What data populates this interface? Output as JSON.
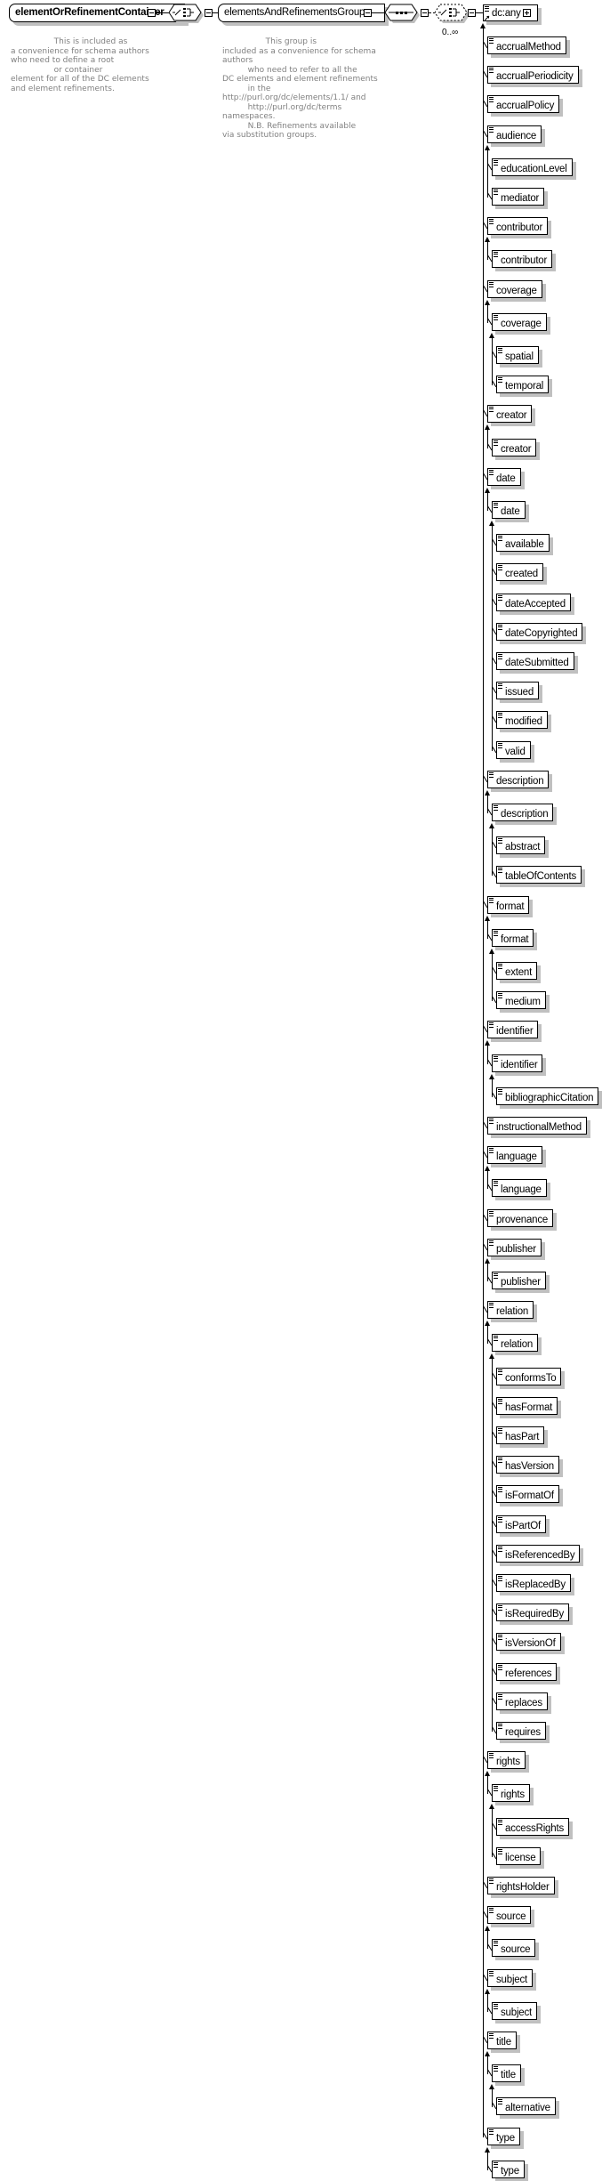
{
  "diagram": {
    "root": {
      "name": "elementOrRefinementContainer",
      "annotation": "                 This is included as\na convenience for schema authors\nwho need to define a root\n                 or container\nelement for all of the DC elements\nand element refinements."
    },
    "group": {
      "name": "elementsAndRefinementsGroup",
      "annotation": "                 This group is\nincluded as a convenience for schema\nauthors\n          who need to refer to all the\nDC elements and element refinements\n          in the\nhttp://purl.org/dc/elements/1.1/ and\n          http://purl.org/dc/terms\nnamespaces.\n          N.B. Refinements available\nvia substitution groups."
    },
    "choice_occurrence": "0..∞",
    "any_element": "dc:any",
    "elements": [
      {
        "label": "accrualMethod",
        "level": 1
      },
      {
        "label": "accrualPeriodicity",
        "level": 1
      },
      {
        "label": "accrualPolicy",
        "level": 1
      },
      {
        "label": "audience",
        "level": 1
      },
      {
        "label": "educationLevel",
        "level": 2
      },
      {
        "label": "mediator",
        "level": 2
      },
      {
        "label": "contributor",
        "level": 1
      },
      {
        "label": "contributor",
        "level": 2
      },
      {
        "label": "coverage",
        "level": 1
      },
      {
        "label": "coverage",
        "level": 2
      },
      {
        "label": "spatial",
        "level": 3
      },
      {
        "label": "temporal",
        "level": 3
      },
      {
        "label": "creator",
        "level": 1
      },
      {
        "label": "creator",
        "level": 2
      },
      {
        "label": "date",
        "level": 1
      },
      {
        "label": "date",
        "level": 2
      },
      {
        "label": "available",
        "level": 3
      },
      {
        "label": "created",
        "level": 3
      },
      {
        "label": "dateAccepted",
        "level": 3
      },
      {
        "label": "dateCopyrighted",
        "level": 3
      },
      {
        "label": "dateSubmitted",
        "level": 3
      },
      {
        "label": "issued",
        "level": 3
      },
      {
        "label": "modified",
        "level": 3
      },
      {
        "label": "valid",
        "level": 3
      },
      {
        "label": "description",
        "level": 1
      },
      {
        "label": "description",
        "level": 2
      },
      {
        "label": "abstract",
        "level": 3
      },
      {
        "label": "tableOfContents",
        "level": 3
      },
      {
        "label": "format",
        "level": 1
      },
      {
        "label": "format",
        "level": 2
      },
      {
        "label": "extent",
        "level": 3
      },
      {
        "label": "medium",
        "level": 3
      },
      {
        "label": "identifier",
        "level": 1
      },
      {
        "label": "identifier",
        "level": 2
      },
      {
        "label": "bibliographicCitation",
        "level": 3
      },
      {
        "label": "instructionalMethod",
        "level": 1
      },
      {
        "label": "language",
        "level": 1
      },
      {
        "label": "language",
        "level": 2
      },
      {
        "label": "provenance",
        "level": 1
      },
      {
        "label": "publisher",
        "level": 1
      },
      {
        "label": "publisher",
        "level": 2
      },
      {
        "label": "relation",
        "level": 1
      },
      {
        "label": "relation",
        "level": 2
      },
      {
        "label": "conformsTo",
        "level": 3
      },
      {
        "label": "hasFormat",
        "level": 3
      },
      {
        "label": "hasPart",
        "level": 3
      },
      {
        "label": "hasVersion",
        "level": 3
      },
      {
        "label": "isFormatOf",
        "level": 3
      },
      {
        "label": "isPartOf",
        "level": 3
      },
      {
        "label": "isReferencedBy",
        "level": 3
      },
      {
        "label": "isReplacedBy",
        "level": 3
      },
      {
        "label": "isRequiredBy",
        "level": 3
      },
      {
        "label": "isVersionOf",
        "level": 3
      },
      {
        "label": "references",
        "level": 3
      },
      {
        "label": "replaces",
        "level": 3
      },
      {
        "label": "requires",
        "level": 3
      },
      {
        "label": "rights",
        "level": 1
      },
      {
        "label": "rights",
        "level": 2
      },
      {
        "label": "accessRights",
        "level": 3
      },
      {
        "label": "license",
        "level": 3
      },
      {
        "label": "rightsHolder",
        "level": 1
      },
      {
        "label": "source",
        "level": 1
      },
      {
        "label": "source",
        "level": 2
      },
      {
        "label": "subject",
        "level": 1
      },
      {
        "label": "subject",
        "level": 2
      },
      {
        "label": "title",
        "level": 1
      },
      {
        "label": "title",
        "level": 2
      },
      {
        "label": "alternative",
        "level": 3
      },
      {
        "label": "type",
        "level": 1
      },
      {
        "label": "type",
        "level": 2
      }
    ]
  }
}
